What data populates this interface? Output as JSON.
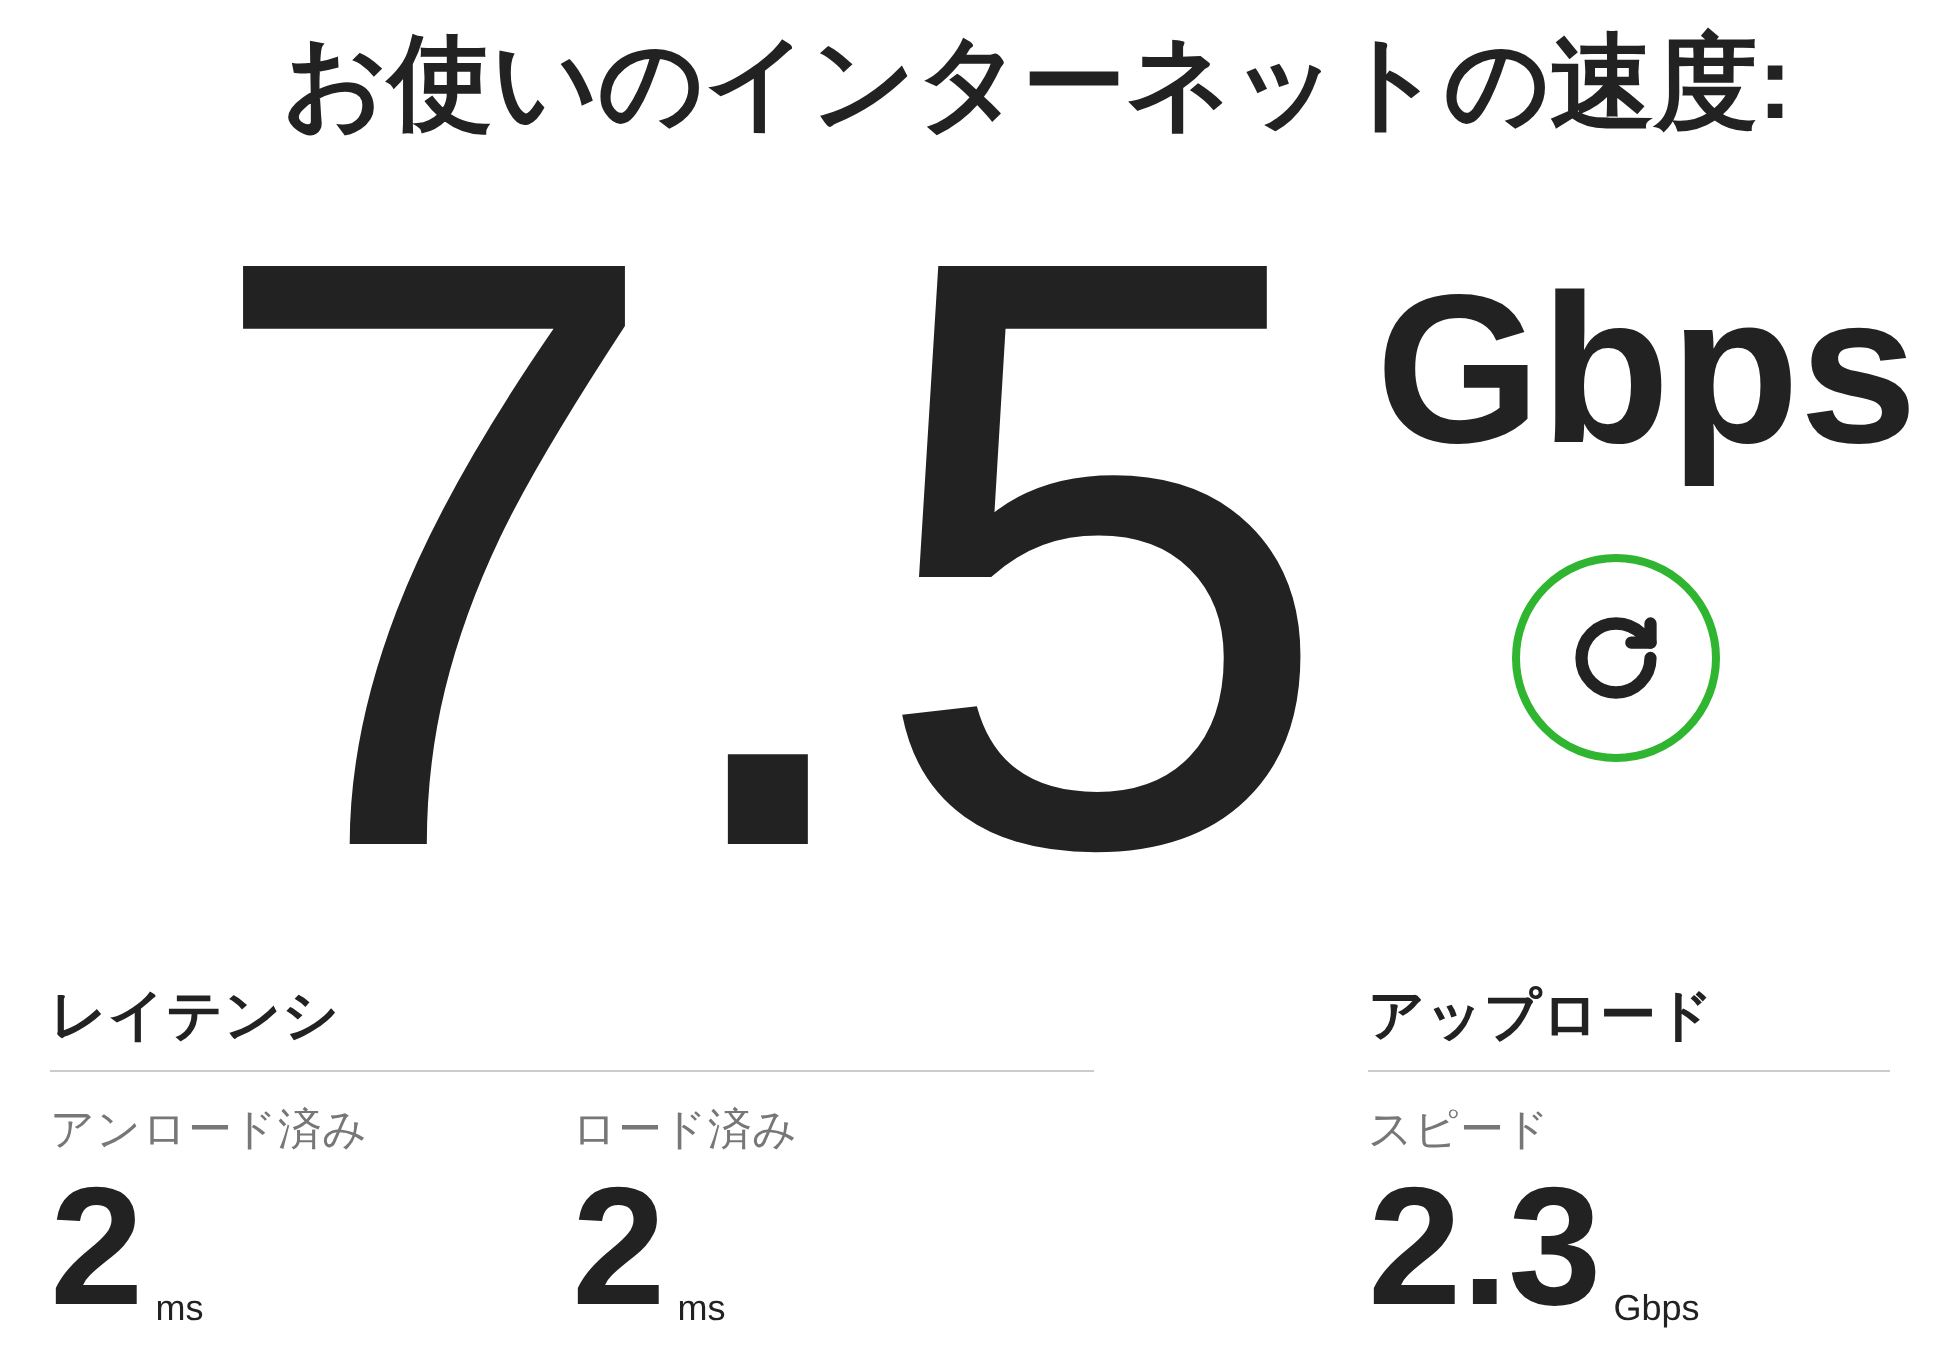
{
  "title": "お使いのインターネットの速度:",
  "speed": {
    "value": "7.5",
    "unit": "Gbps"
  },
  "refresh": {
    "kind": "done"
  },
  "sections": [
    {
      "heading": "レイテンシ",
      "metrics": [
        {
          "label": "アンロード済み",
          "value": "2",
          "unit": "ms"
        },
        {
          "label": "ロード済み",
          "value": "2",
          "unit": "ms"
        }
      ]
    },
    {
      "heading": "アップロード",
      "metrics": [
        {
          "label": "スピード",
          "value": "2.3",
          "unit": "Gbps"
        }
      ]
    }
  ]
}
